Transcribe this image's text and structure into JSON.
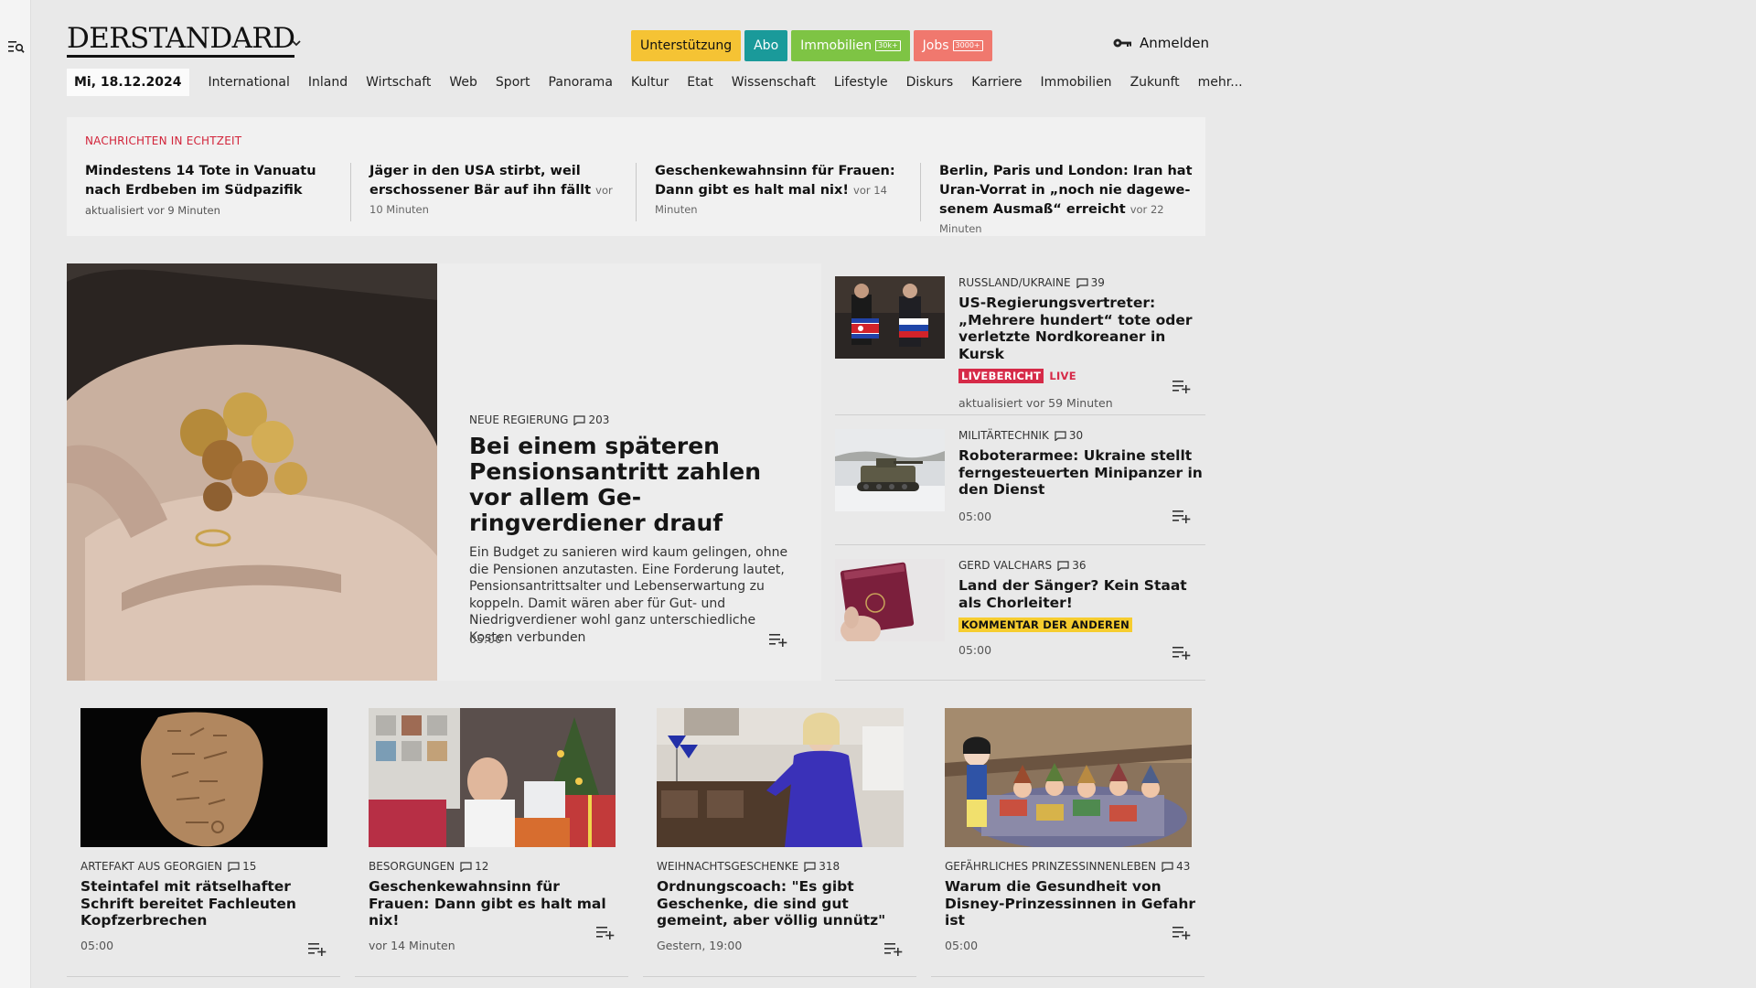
{
  "header": {
    "logo_text": "DERSTANDARD",
    "buttons": {
      "support": "Unterstützung",
      "abo": "Abo",
      "immobilien": "Immobilien",
      "immobilien_badge": "30k+",
      "jobs": "Jobs",
      "jobs_badge": "3000+"
    },
    "login": "Anmelden",
    "colors": {
      "support": "#f5c334",
      "abo": "#1a9a9a",
      "immobilien": "#7ec444",
      "jobs": "#f0786e"
    }
  },
  "nav": {
    "date": "Mi, 18.12.2024",
    "items": [
      "International",
      "Inland",
      "Wirtschaft",
      "Web",
      "Sport",
      "Panorama",
      "Kultur",
      "Etat",
      "Wissenschaft",
      "Lifestyle",
      "Diskurs",
      "Karriere",
      "Immobilien",
      "Zukunft",
      "mehr..."
    ]
  },
  "ticker": {
    "heading": "NACHRICHTEN IN ECHTZEIT",
    "items": [
      {
        "title": "Mindestens 14 Tote in Vanuatu nach Erdbeben im Südpazifik",
        "updated": "aktualisiert vor 9 Minuten"
      },
      {
        "title": "Jäger in den USA stirbt, weil erschos­sener Bär auf ihn fällt",
        "ago": "vor 10 Minuten"
      },
      {
        "title": "Geschenkewahnsinn für Frauen: Dann gibt es halt mal nix!",
        "ago": "vor 14 Minuten"
      },
      {
        "title": "Berlin, Paris und London: Iran hat Uran-Vorrat in „noch nie dagewe­senem Ausmaß“ erreicht",
        "ago": "vor 22 Minuten"
      }
    ]
  },
  "hero": {
    "kicker": "NEUE REGIERUNG",
    "comments": "203",
    "title": "Bei einem späteren Pensions­antritt zahlen vor allem Ge­ringverdiener drauf",
    "lead": "Ein Budget zu sanieren wird kaum gelingen, ohne die Pensionen anzutasten. Eine Forderung lautet, Pensionsantrittsalter und Lebenserwartung zu koppeln. Damit wären aber für Gut- und Niedrigver­diener wohl ganz unterschiedliche Kosten verbunden",
    "time": "05:00"
  },
  "side": [
    {
      "kicker": "RUSSLAND/UKRAINE",
      "comments": "39",
      "title": "US-Regierungsvertreter: „Mehrere hundert“ tote oder verletzte Nordkoreaner in Kursk",
      "tag": "LIVEBERICHT",
      "tag2": "LIVE",
      "time": "aktualisiert vor 59 Minuten"
    },
    {
      "kicker": "MILITÄRTECHNIK",
      "comments": "30",
      "title": "Roboterarmee: Ukraine stellt ferngesteuerten Minipanzer in den Dienst",
      "time": "05:00"
    },
    {
      "kicker": "GERD VALCHARS",
      "comments": "36",
      "title": "Land der Sänger? Kein Staat als Chorleiter!",
      "tag": "KOMMENTAR DER ANDEREN",
      "time": "05:00"
    }
  ],
  "cards": [
    {
      "kicker": "ARTEFAKT AUS GEORGIEN",
      "comments": "15",
      "title": "Steintafel mit rätselhafter Schrift bereitet Fachleuten Kopfzerbrechen",
      "time": "05:00"
    },
    {
      "kicker": "BESORGUNGEN",
      "comments": "12",
      "title": "Geschenkewahnsinn für Frauen: Dann gibt es halt mal nix!",
      "time": "vor 14 Minuten"
    },
    {
      "kicker": "WEIHNACHTSGESCHENKE",
      "comments": "318",
      "title": "Ordnungscoach: \"Es gibt Geschenke, die sind gut gemeint, aber völlig unnütz\"",
      "time": "Gestern, 19:00"
    },
    {
      "kicker": "GEFÄHRLICHES PRINZESSINNENLEBEN",
      "comments": "43",
      "title": "Warum die Gesundheit von Dis­ney-Prinzessinnen in Gefahr ist",
      "time": "05:00"
    }
  ],
  "icons": {
    "rail": "search-menu-icon",
    "chevron": "chevron-down-icon",
    "login": "key-icon",
    "comment": "comment-icon",
    "add": "add-to-list-icon"
  }
}
